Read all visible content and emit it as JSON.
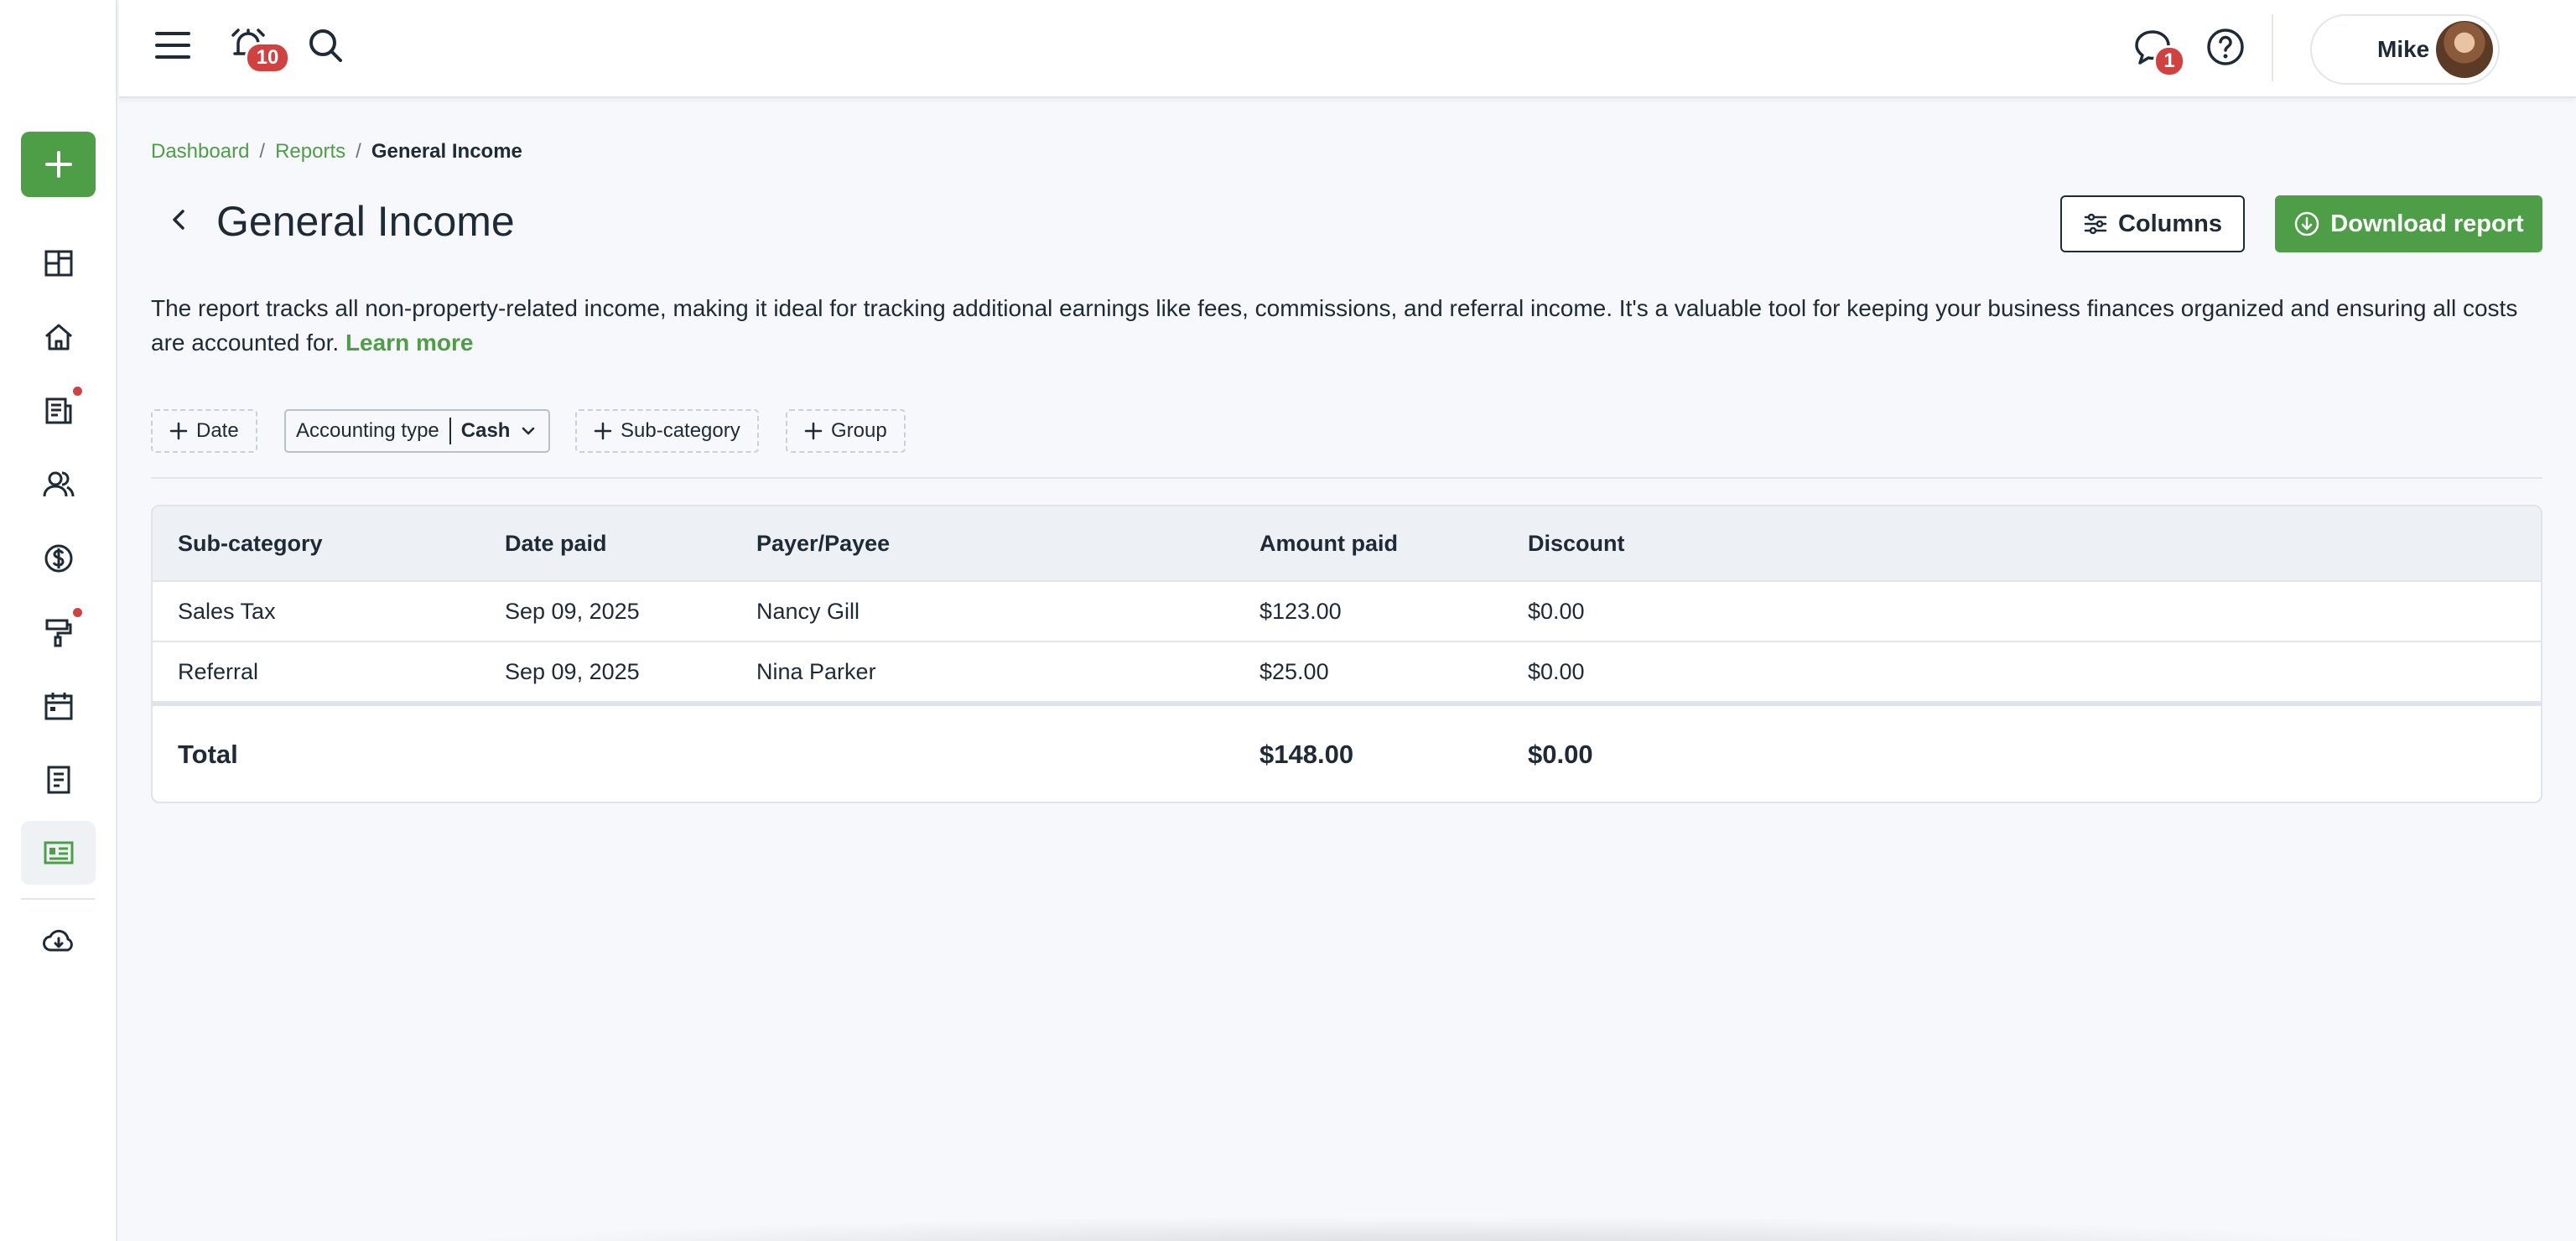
{
  "header": {
    "reminders_badge": "10",
    "messages_badge": "1",
    "user_name": "Mike"
  },
  "breadcrumb": {
    "items": [
      "Dashboard",
      "Reports"
    ],
    "current": "General Income"
  },
  "page": {
    "title": "General Income",
    "columns_label": "Columns",
    "download_label": "Download report",
    "description": "The report tracks all non-property-related income, making it ideal for tracking additional earnings like fees, commissions, and referral income. It's a valuable tool for keeping your business finances organized and ensuring all costs are accounted for.",
    "learn_more": "Learn more"
  },
  "filters": {
    "date": "Date",
    "accounting_type_label": "Accounting type",
    "accounting_type_value": "Cash",
    "sub_category": "Sub-category",
    "group": "Group"
  },
  "table": {
    "columns": [
      "Sub-category",
      "Date paid",
      "Payer/Payee",
      "Amount paid",
      "Discount"
    ],
    "rows": [
      [
        "Sales Tax",
        "Sep 09, 2025",
        "Nancy Gill",
        "$123.00",
        "$0.00"
      ],
      [
        "Referral",
        "Sep 09, 2025",
        "Nina Parker",
        "$25.00",
        "$0.00"
      ]
    ],
    "total": {
      "label": "Total",
      "amount_paid": "$148.00",
      "discount": "$0.00"
    }
  },
  "colors": {
    "accent": "#4e9d47",
    "badge": "#d0413f",
    "text": "#1f2a37"
  },
  "icons": {
    "sidebar": [
      "plus-icon",
      "dashboard-icon",
      "home-icon",
      "leases-icon",
      "people-icon",
      "dollar-icon",
      "maintenance-icon",
      "calendar-icon",
      "document-icon",
      "reports-icon",
      "download-cloud-icon"
    ],
    "top": [
      "menu-icon",
      "alarm-icon",
      "search-icon",
      "chat-icon",
      "help-icon"
    ]
  }
}
